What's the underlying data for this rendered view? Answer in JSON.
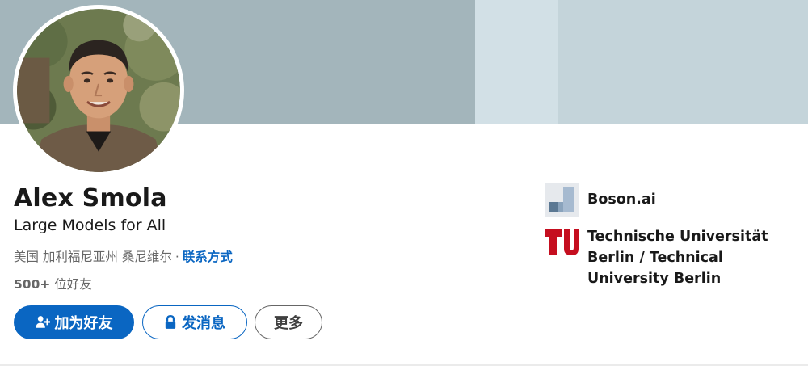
{
  "profile": {
    "name": "Alex Smola",
    "headline": "Large Models for All",
    "location": "美国 加利福尼亚州 桑尼维尔",
    "separator": "·",
    "contact_info_label": "联系方式",
    "connections_count": "500+",
    "connections_label": "位好友"
  },
  "actions": {
    "connect_label": "加为好友",
    "message_label": "发消息",
    "more_label": "更多"
  },
  "organizations": [
    {
      "name": "Boson.ai",
      "logo": "boson-logo"
    },
    {
      "name": "Technische Universität Berlin / Technical University Berlin",
      "logo": "tu-berlin-logo"
    }
  ],
  "colors": {
    "primary": "#0a66c2",
    "text": "#191919",
    "muted": "#666666",
    "banner_dark": "#a3b5bb",
    "banner_light": "#dfe8ec",
    "tu_red": "#c50e1f"
  }
}
